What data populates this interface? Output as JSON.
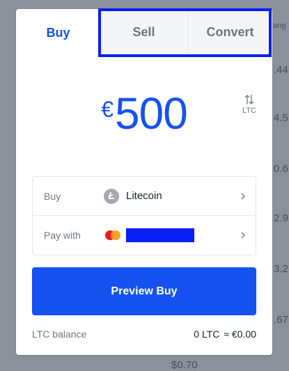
{
  "background": {
    "fragments": [
      "ang",
      ".44",
      "4.5",
      "0.6",
      "2.9",
      "3.2",
      ".67",
      "$0.70"
    ]
  },
  "tabs": [
    {
      "label": "Buy",
      "active": true
    },
    {
      "label": "Sell",
      "active": false
    },
    {
      "label": "Convert",
      "active": false
    }
  ],
  "amount": {
    "currency_symbol": "€",
    "value": "500"
  },
  "unit_toggle": {
    "icon": "swap-vertical-arrows-icon",
    "label": "LTC"
  },
  "details": {
    "buy": {
      "label": "Buy",
      "asset": "Litecoin",
      "icon": "litecoin-icon"
    },
    "pay_with": {
      "label": "Pay with",
      "icon": "mastercard-icon",
      "value": ""
    }
  },
  "button": {
    "label": "Preview Buy"
  },
  "balance": {
    "label": "LTC balance",
    "crypto": "0 LTC",
    "fiat": "≈ €0.00"
  },
  "colors": {
    "accent": "#1652f0",
    "highlight": "#0a1ef5",
    "backdrop": "#8a919b"
  }
}
